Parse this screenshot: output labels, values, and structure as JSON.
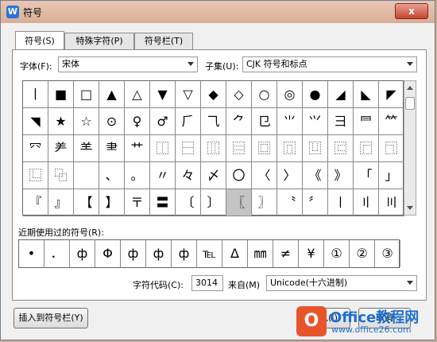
{
  "window": {
    "title": "符号",
    "app_icon": "W",
    "close_label": "x"
  },
  "tabs": [
    {
      "label": "符号(S)",
      "active": true
    },
    {
      "label": "特殊字符(P)",
      "active": false
    },
    {
      "label": "符号栏(T)",
      "active": false
    }
  ],
  "font": {
    "label": "字体(F):",
    "value": "宋体"
  },
  "subset": {
    "label": "子集(U):",
    "value": "CJK 符号和标点"
  },
  "grid": {
    "selected_index": 68,
    "rows": [
      [
        "丨",
        "■",
        "□",
        "▲",
        "△",
        "▼",
        "▽",
        "◆",
        "◇",
        "○",
        "◎",
        "●",
        "◢",
        "◣",
        "◤"
      ],
      [
        "◥",
        "★",
        "☆",
        "⊙",
        "♀",
        "♂",
        "⺁",
        "⺄",
        "⺈",
        "⺋",
        "⺌",
        "⺍",
        "⺕",
        "⺜",
        "⺮"
      ],
      [
        "⺳",
        "⺶",
        "⺷",
        "⺻",
        "⺾",
        "⿰",
        "⿱",
        "⿲",
        "⿳",
        "⿴",
        "⿵",
        "⿶",
        "⿷",
        "⿸",
        "⿹"
      ],
      [
        "⿺",
        "⿻",
        "",
        "、",
        "。",
        "〃",
        "々",
        "〆",
        "〇",
        "〈",
        "〉",
        "《",
        "》",
        "「",
        "」"
      ],
      [
        "『",
        "』",
        "【",
        "】",
        "〒",
        "〓",
        "〔",
        "〕",
        "〖",
        "〗",
        "〝",
        "〞",
        "〡",
        "〢",
        "〣"
      ]
    ]
  },
  "recent": {
    "label": "近期使用过的符号(R):",
    "symbols": [
      "•",
      "．",
      "ф",
      "Φ",
      "ф",
      "ф",
      "ф",
      "℡",
      "Δ",
      "㎜",
      "≠",
      "¥",
      "①",
      "②",
      "③"
    ]
  },
  "char_code": {
    "label": "字符代码(C):",
    "value": "3014"
  },
  "from": {
    "label": "来自(M)",
    "value": "Unicode(十六进制)"
  },
  "buttons": {
    "insert_to_bar": "插入到符号栏(Y)",
    "insert": "插入(I)",
    "cancel": "取消"
  },
  "watermark": {
    "logo": "O",
    "line1": "Office教程网",
    "line2": "www.office26.com"
  }
}
